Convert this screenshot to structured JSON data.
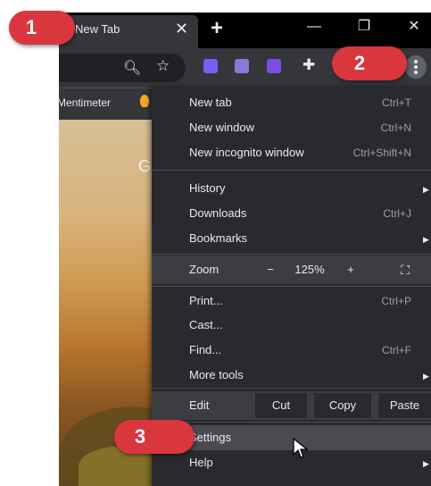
{
  "tabs": [
    {
      "title": "New Tab"
    }
  ],
  "window_controls": [
    "minimize",
    "restore",
    "close"
  ],
  "bookmarks": [
    {
      "label": "Mentimeter"
    }
  ],
  "menu": {
    "items": [
      {
        "label": "New tab",
        "shortcut": "Ctrl+T"
      },
      {
        "label": "New window",
        "shortcut": "Ctrl+N"
      },
      {
        "label": "New incognito window",
        "shortcut": "Ctrl+Shift+N"
      },
      {
        "label": "History"
      },
      {
        "label": "Downloads",
        "shortcut": "Ctrl+J"
      },
      {
        "label": "Bookmarks"
      },
      {
        "label": "Print...",
        "shortcut": "Ctrl+P"
      },
      {
        "label": "Cast..."
      },
      {
        "label": "Find...",
        "shortcut": "Ctrl+F"
      },
      {
        "label": "More tools"
      },
      {
        "label": "Settings"
      },
      {
        "label": "Help"
      }
    ],
    "zoom": {
      "label": "Zoom",
      "minus": "−",
      "level": "125%",
      "plus": "+"
    },
    "edit": {
      "label": "Edit",
      "cut": "Cut",
      "copy": "Copy",
      "paste": "Paste"
    }
  },
  "callouts": [
    "1",
    "2",
    "3"
  ],
  "page": {
    "partial_text": "G"
  },
  "colors": {
    "callout": "#d9363e",
    "menu_bg": "#292a2d",
    "toolbar_bg": "#35363a",
    "highlight": "#4a4b4f"
  }
}
